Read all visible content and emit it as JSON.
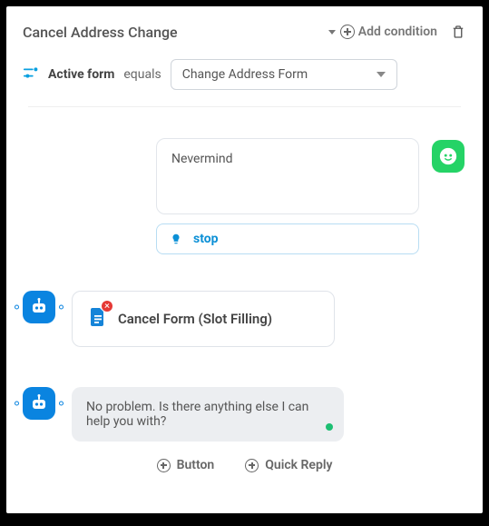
{
  "header": {
    "title": "Cancel Address Change",
    "add_condition_label": "Add condition"
  },
  "condition": {
    "field_label": "Active form",
    "operator": "equals",
    "value": "Change Address Form"
  },
  "user": {
    "message": "Nevermind",
    "intent_label": "stop"
  },
  "bot_action": {
    "label": "Cancel Form (Slot Filling)"
  },
  "bot_reply": {
    "text": "No problem. Is there anything else I can help you with?"
  },
  "footer": {
    "button_label": "Button",
    "quick_reply_label": "Quick Reply"
  },
  "icons": {
    "condition": "filter-icon",
    "trash": "trash-icon",
    "user_avatar": "user-bot-icon",
    "bot_avatar": "bot-icon",
    "intent": "lightbulb-icon",
    "document": "document-icon"
  }
}
